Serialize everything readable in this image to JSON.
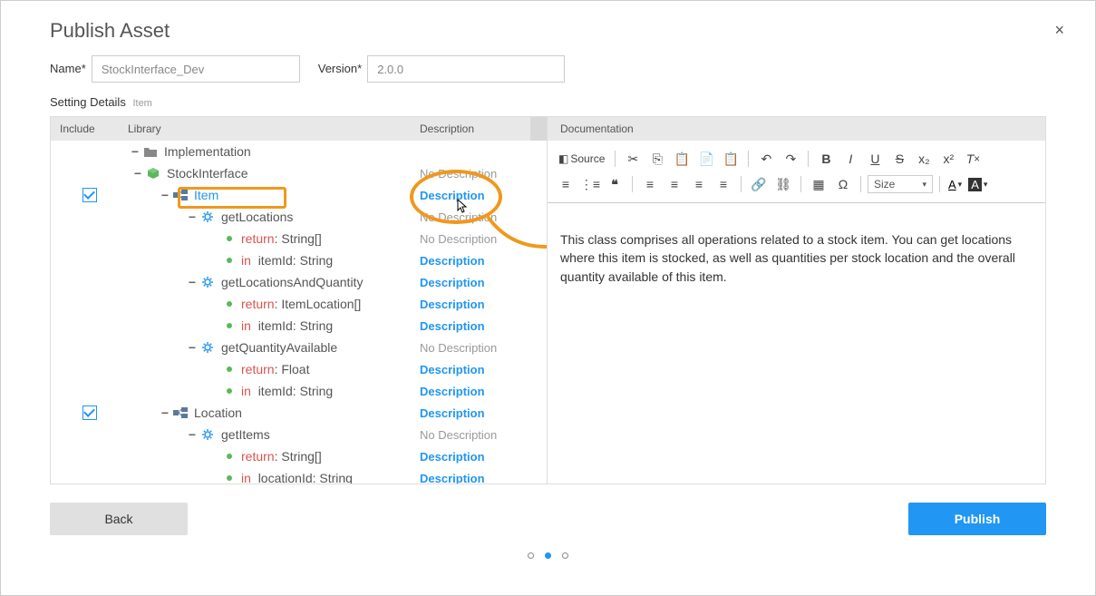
{
  "dialog": {
    "title": "Publish Asset",
    "close": "×"
  },
  "form": {
    "name_label": "Name",
    "name_value": "StockInterface_Dev",
    "version_label": "Version",
    "version_value": "2.0.0"
  },
  "setting": {
    "label": "Setting Details",
    "context": "Item"
  },
  "headers": {
    "include": "Include",
    "library": "Library",
    "description": "Description",
    "documentation": "Documentation"
  },
  "desc": {
    "link": "Description",
    "none": "No Description"
  },
  "tree": [
    {
      "indent": 0,
      "expand": "−",
      "icon": "folder",
      "label": "Implementation",
      "checkbox": false,
      "desc": "",
      "blue": false
    },
    {
      "indent": 1,
      "expand": "−",
      "icon": "cube",
      "label": "StockInterface",
      "checkbox": false,
      "desc": "none",
      "blue": false
    },
    {
      "indent": 2,
      "expand": "−",
      "icon": "node",
      "label": "Item",
      "checkbox": true,
      "checked": true,
      "desc": "link",
      "blue": true,
      "highlighted": true
    },
    {
      "indent": 3,
      "expand": "−",
      "icon": "gear",
      "label": "getLocations",
      "checkbox": false,
      "desc": "none",
      "blue": false
    },
    {
      "indent": 4,
      "expand": "",
      "icon": "dot",
      "prefix": "return",
      "type": "String[]",
      "checkbox": false,
      "desc": "none",
      "blue": false
    },
    {
      "indent": 4,
      "expand": "",
      "icon": "dot",
      "prefix": "in",
      "name": "itemId",
      "type": "String",
      "checkbox": false,
      "desc": "link",
      "blue": false
    },
    {
      "indent": 3,
      "expand": "−",
      "icon": "gear",
      "label": "getLocationsAndQuantity",
      "checkbox": false,
      "desc": "link",
      "blue": false
    },
    {
      "indent": 4,
      "expand": "",
      "icon": "dot",
      "prefix": "return",
      "type": "ItemLocation[]",
      "checkbox": false,
      "desc": "link",
      "blue": false
    },
    {
      "indent": 4,
      "expand": "",
      "icon": "dot",
      "prefix": "in",
      "name": "itemId",
      "type": "String",
      "checkbox": false,
      "desc": "link",
      "blue": false
    },
    {
      "indent": 3,
      "expand": "−",
      "icon": "gear",
      "label": "getQuantityAvailable",
      "checkbox": false,
      "desc": "none",
      "blue": false
    },
    {
      "indent": 4,
      "expand": "",
      "icon": "dot",
      "prefix": "return",
      "type": "Float",
      "checkbox": false,
      "desc": "link",
      "blue": false
    },
    {
      "indent": 4,
      "expand": "",
      "icon": "dot",
      "prefix": "in",
      "name": "itemId",
      "type": "String",
      "checkbox": false,
      "desc": "link",
      "blue": false
    },
    {
      "indent": 2,
      "expand": "−",
      "icon": "node",
      "label": "Location",
      "checkbox": true,
      "checked": true,
      "desc": "link",
      "blue": false
    },
    {
      "indent": 3,
      "expand": "−",
      "icon": "gear",
      "label": "getItems",
      "checkbox": false,
      "desc": "none",
      "blue": false
    },
    {
      "indent": 4,
      "expand": "",
      "icon": "dot",
      "prefix": "return",
      "type": "String[]",
      "checkbox": false,
      "desc": "link",
      "blue": false
    },
    {
      "indent": 4,
      "expand": "",
      "icon": "dot",
      "prefix": "in",
      "name": "locationId",
      "type": "String",
      "checkbox": false,
      "desc": "link",
      "blue": false
    }
  ],
  "toolbar": {
    "source": "Source",
    "size": "Size"
  },
  "editor": {
    "content": "This class comprises all operations related to a stock item. You can get locations where this item is stocked, as well as quantities per stock location and the overall quantity available of this item."
  },
  "footer": {
    "back": "Back",
    "publish": "Publish"
  }
}
